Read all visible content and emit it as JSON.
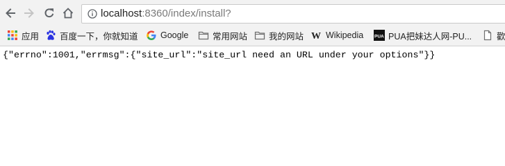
{
  "browser": {
    "nav": {
      "back_icon": "arrow-left-icon",
      "forward_icon": "arrow-right-icon",
      "reload_icon": "reload-icon",
      "home_icon": "home-icon"
    },
    "address": {
      "host": "localhost",
      "rest": ":8360/index/install?"
    },
    "bookmarks": [
      {
        "label": "应用",
        "icon": "apps-grid-icon"
      },
      {
        "label": "百度一下，你就知道",
        "icon": "baidu-paw-icon"
      },
      {
        "label": "Google",
        "icon": "google-g-icon"
      },
      {
        "label": "常用网站",
        "icon": "folder-icon"
      },
      {
        "label": "我的网站",
        "icon": "folder-icon"
      },
      {
        "label": "Wikipedia",
        "icon": "wikipedia-w-icon"
      },
      {
        "label": "PUA把妹达人网-PU...",
        "icon": "pua-logo-icon"
      },
      {
        "label": "歡迎",
        "icon": "page-icon"
      }
    ]
  },
  "page": {
    "body_text": "{\"errno\":1001,\"errmsg\":{\"site_url\":\"site_url need an URL under your options\"}}"
  },
  "colors": {
    "toolbar_bg": "#f2f2f2",
    "folder": "#6e6e6e",
    "google_blue": "#4285f4",
    "baidu_blue": "#2932e1"
  }
}
